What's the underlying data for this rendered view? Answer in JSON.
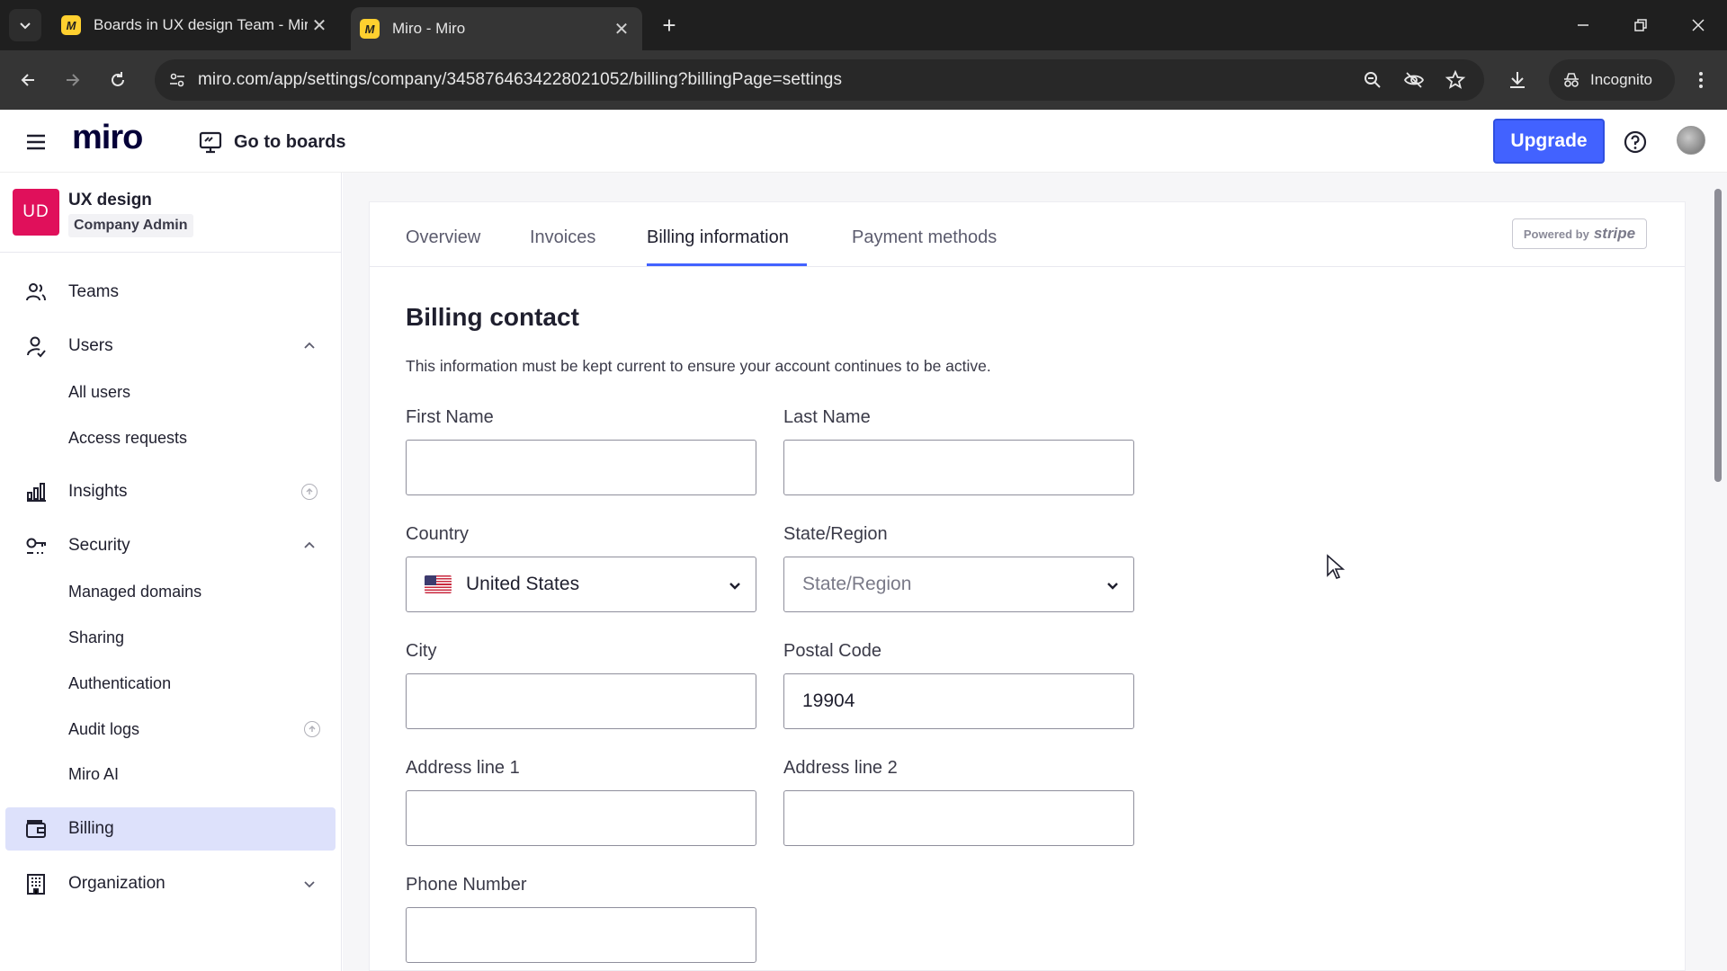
{
  "browser": {
    "tabs": [
      {
        "title": "Boards in UX design Team - Miro",
        "favicon": "miro-favicon-icon"
      },
      {
        "title": "Miro - Miro",
        "favicon": "miro-favicon-icon"
      }
    ],
    "url": "miro.com/app/settings/company/3458764634228021052/billing?billingPage=settings",
    "incognito_label": "Incognito"
  },
  "header": {
    "logo": "miro",
    "go_to_boards": "Go to boards",
    "upgrade": "Upgrade",
    "accent": "#4262ff"
  },
  "sidebar": {
    "org_initials": "UD",
    "org_name": "UX design",
    "org_role": "Company Admin",
    "org_color": "#e0105b",
    "items": [
      {
        "label": "Teams",
        "icon": "teams-icon"
      },
      {
        "label": "Users",
        "icon": "users-icon",
        "expanded": true
      },
      {
        "label": "All users"
      },
      {
        "label": "Access requests"
      },
      {
        "label": "Insights",
        "icon": "insights-icon"
      },
      {
        "label": "Security",
        "icon": "security-icon",
        "expanded": true
      },
      {
        "label": "Managed domains"
      },
      {
        "label": "Sharing"
      },
      {
        "label": "Authentication"
      },
      {
        "label": "Audit logs"
      },
      {
        "label": "Miro AI"
      },
      {
        "label": "Billing",
        "icon": "billing-icon",
        "selected": true
      },
      {
        "label": "Organization",
        "icon": "organization-icon",
        "expanded": false
      }
    ]
  },
  "main": {
    "tabs": [
      {
        "label": "Overview"
      },
      {
        "label": "Invoices"
      },
      {
        "label": "Billing information",
        "active": true
      },
      {
        "label": "Payment methods"
      }
    ],
    "powered_by": "Powered by",
    "stripe": "stripe",
    "section_title": "Billing contact",
    "section_desc": "This information must be kept current to ensure your account continues to be active.",
    "fields": {
      "first_name": {
        "label": "First Name",
        "value": ""
      },
      "last_name": {
        "label": "Last Name",
        "value": ""
      },
      "country": {
        "label": "Country",
        "value": "United States"
      },
      "state": {
        "label": "State/Region",
        "placeholder": "State/Region"
      },
      "city": {
        "label": "City",
        "value": ""
      },
      "postal": {
        "label": "Postal Code",
        "value": "19904"
      },
      "address1": {
        "label": "Address line 1",
        "value": ""
      },
      "address2": {
        "label": "Address line 2",
        "value": ""
      },
      "phone": {
        "label": "Phone Number",
        "value": ""
      }
    }
  }
}
